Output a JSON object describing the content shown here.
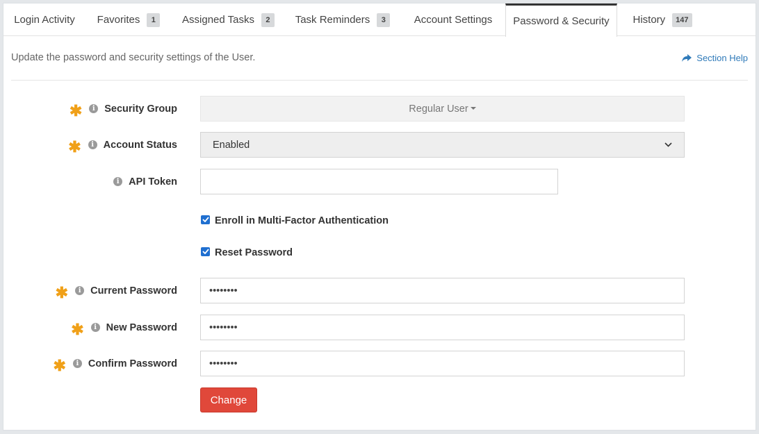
{
  "tabs": [
    {
      "label": "Login Activity",
      "badge": ""
    },
    {
      "label": "Favorites",
      "badge": "1"
    },
    {
      "label": "Assigned Tasks",
      "badge": "2"
    },
    {
      "label": "Task Reminders",
      "badge": "3"
    },
    {
      "label": "Account Settings",
      "badge": ""
    },
    {
      "label": "Password & Security",
      "badge": ""
    },
    {
      "label": "History",
      "badge": "147"
    }
  ],
  "active_tab": "Password & Security",
  "intro": "Update the password and security settings of the User.",
  "section_help": "Section Help",
  "fields": {
    "security_group": {
      "label": "Security Group",
      "value": "Regular User"
    },
    "account_status": {
      "label": "Account Status",
      "value": "Enabled"
    },
    "api_token": {
      "label": "API Token",
      "value": ""
    },
    "mfa": {
      "label": "Enroll in Multi-Factor Authentication",
      "checked": true
    },
    "reset_password": {
      "label": "Reset Password",
      "checked": true
    },
    "current_password": {
      "label": "Current Password",
      "value": "••••••••"
    },
    "new_password": {
      "label": "New Password",
      "value": "••••••••"
    },
    "confirm_password": {
      "label": "Confirm Password",
      "value": "••••••••"
    }
  },
  "submit_label": "Change",
  "colors": {
    "required": "#f0a018",
    "link": "#2f7ab9",
    "button": "#e0483a",
    "checkbox": "#1f6fd0"
  },
  "icons": {
    "required": "asterisk-icon",
    "info": "info-icon",
    "help": "share-arrow-icon",
    "dropdown": "chevron-down-icon"
  }
}
